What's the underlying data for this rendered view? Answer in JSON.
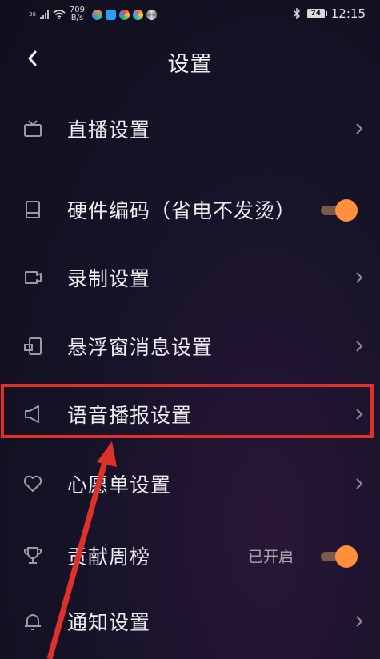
{
  "status_bar": {
    "net_speed": "709",
    "net_unit": "B/s",
    "signal": "36",
    "battery": "74",
    "time": "12:15"
  },
  "header": {
    "title": "设置"
  },
  "settings": {
    "items": [
      {
        "label": "直播设置",
        "icon": "tv-icon",
        "control": "chevron"
      },
      {
        "label": "硬件编码（省电不发烫）",
        "icon": "hardware-icon",
        "control": "toggle",
        "toggle_on": true
      },
      {
        "label": "录制设置",
        "icon": "record-icon",
        "control": "chevron"
      },
      {
        "label": "悬浮窗消息设置",
        "icon": "floating-window-icon",
        "control": "chevron"
      },
      {
        "label": "语音播报设置",
        "icon": "speaker-icon",
        "control": "chevron",
        "highlighted": true
      },
      {
        "label": "心愿单设置",
        "icon": "heart-icon",
        "control": "chevron"
      },
      {
        "label": "贡献周榜",
        "icon": "trophy-icon",
        "control": "toggle",
        "status": "已开启",
        "toggle_on": true
      },
      {
        "label": "通知设置",
        "icon": "bell-icon",
        "control": "chevron"
      }
    ]
  },
  "colors": {
    "accent": "#ff8e3d",
    "annotation": "#e0302a"
  }
}
